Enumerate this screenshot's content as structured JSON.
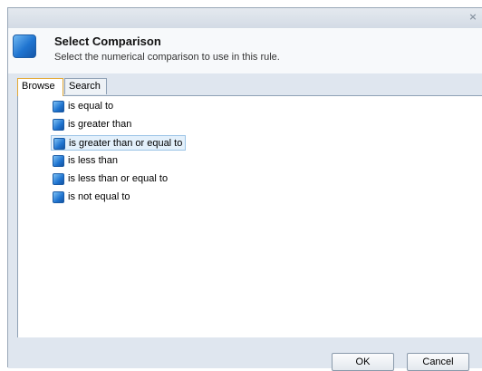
{
  "dialog": {
    "close_glyph": "×",
    "header": {
      "title": "Select Comparison",
      "subtitle": "Select the numerical comparison to use in this rule."
    },
    "tabs": [
      {
        "label": "Browse",
        "active": true
      },
      {
        "label": "Search",
        "active": false
      }
    ],
    "items": [
      {
        "label": "is equal to",
        "selected": false
      },
      {
        "label": "is greater than",
        "selected": false
      },
      {
        "label": "is greater than or equal to",
        "selected": true
      },
      {
        "label": "is less than",
        "selected": false
      },
      {
        "label": "is less than or equal to",
        "selected": false
      },
      {
        "label": "is not equal to",
        "selected": false
      }
    ],
    "buttons": {
      "ok": "OK",
      "cancel": "Cancel"
    },
    "colors": {
      "accent": "#1f74d0",
      "selection": "#e3f0fb",
      "active_tab_border": "#e3a935"
    }
  }
}
